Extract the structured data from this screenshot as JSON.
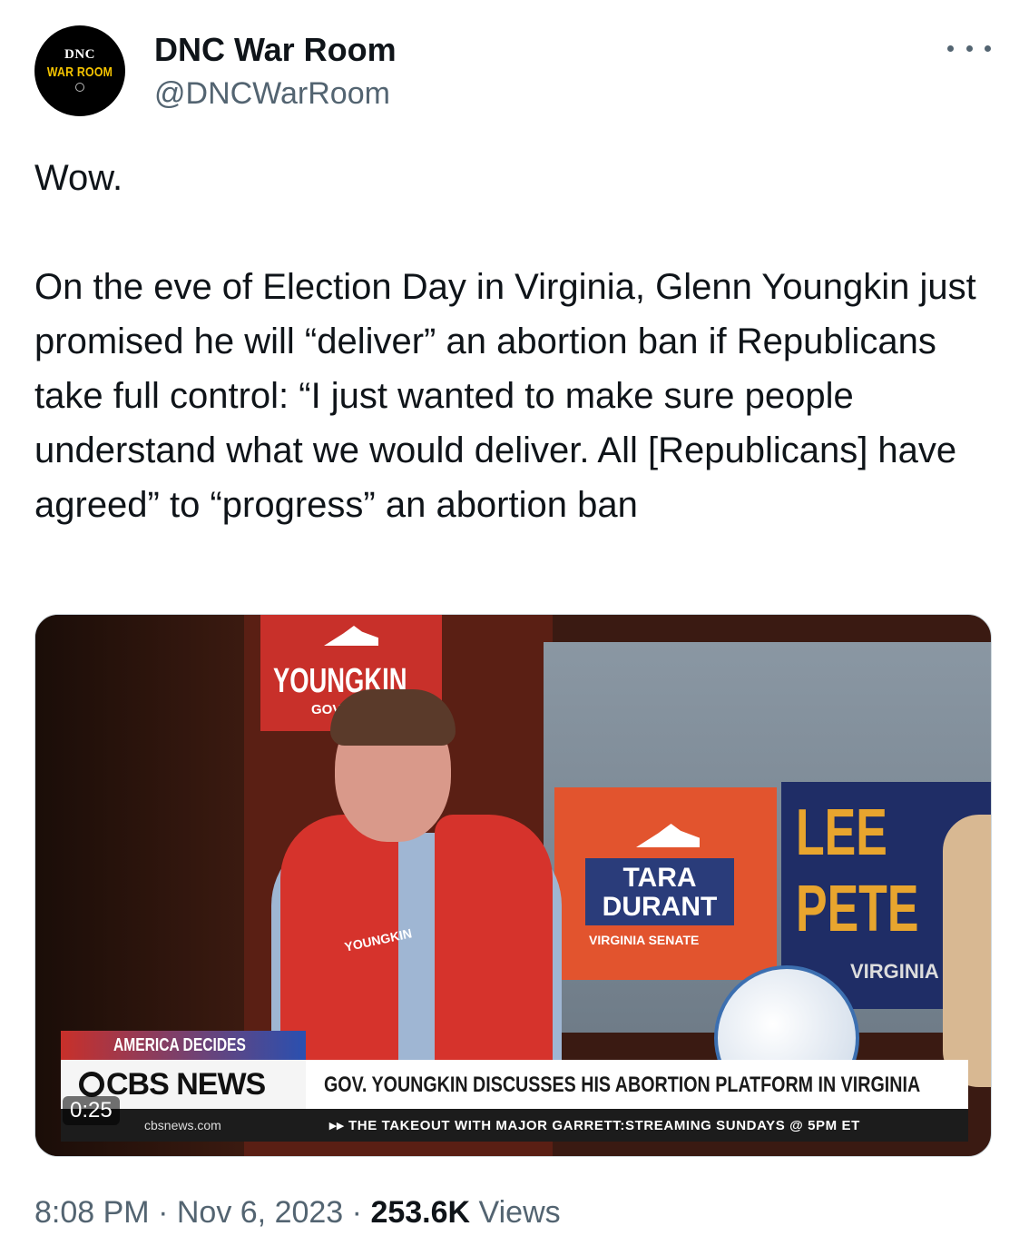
{
  "author": {
    "avatar_lines": [
      "DNC",
      "WAR ROOM"
    ],
    "name": "DNC War Room",
    "handle": "@DNCWarRoom"
  },
  "tweet": {
    "text": "Wow.\n\nOn the eve of Election Day in Virginia, Glenn Youngkin just promised he will “deliver” an abortion ban if Republicans take full control: “I just wanted to make sure people understand what we would deliver. All [Republicans] have agreed” to “progress” an abortion ban"
  },
  "video": {
    "duration": "0:25",
    "signs": {
      "youngkin": "YOUNGKIN",
      "youngkin_sub": "GOV",
      "tara": [
        "TARA",
        "DURANT"
      ],
      "tara_sub": "VIRGINIA SENATE",
      "lee_1": "LEE",
      "lee_2": "PETE",
      "lee_sub": "VIRGINIA"
    },
    "vest_logo": "YOUNGKIN",
    "lower_third": {
      "tag": "AMERICA DECIDES",
      "network": "CBS NEWS",
      "headline": "GOV. YOUNGKIN DISCUSSES HIS ABORTION PLATFORM IN VIRGINIA",
      "site": "cbsnews.com",
      "ticker": "▸▸ THE TAKEOUT WITH MAJOR GARRETT:STREAMING SUNDAYS @ 5PM ET"
    }
  },
  "meta": {
    "time": "8:08 PM",
    "date": "Nov 6, 2023",
    "views_count": "253.6K",
    "views_label": "Views",
    "separator": "·"
  },
  "colors": {
    "text_primary": "#0f1419",
    "text_secondary": "#536471",
    "avatar_accent": "#f5c400"
  },
  "icons": {
    "more": "more-horizontal-icon"
  }
}
